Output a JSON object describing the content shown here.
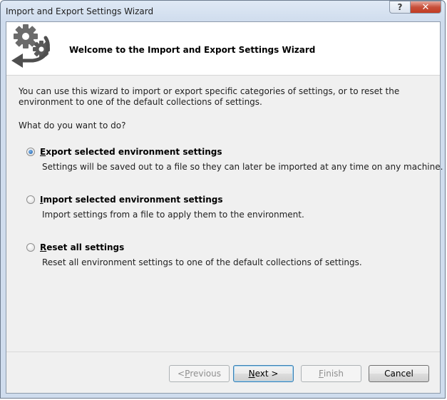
{
  "window": {
    "title": "Import and Export Settings Wizard",
    "help_label": "?",
    "close_label": "✕"
  },
  "banner": {
    "title": "Welcome to the Import and Export Settings Wizard",
    "icon": "gears-arrow-icon"
  },
  "intro": "You can use this wizard to import or export specific categories of settings, or to reset the environment to one of the default collections of settings.",
  "question": "What do you want to do?",
  "options": [
    {
      "label_accel": "E",
      "label_rest": "xport selected environment settings",
      "description": "Settings will be saved out to a file so they can later be imported at any time on any machine.",
      "selected": true
    },
    {
      "label_accel": "I",
      "label_rest": "mport selected environment settings",
      "description": "Import settings from a file to apply them to the environment.",
      "selected": false
    },
    {
      "label_accel": "R",
      "label_rest": "eset all settings",
      "description": "Reset all environment settings to one of the default collections of settings.",
      "selected": false
    }
  ],
  "buttons": {
    "previous": {
      "pre": "< ",
      "accel": "P",
      "rest": "revious",
      "enabled": false
    },
    "next": {
      "pre": "",
      "accel": "N",
      "rest": "ext >",
      "enabled": true
    },
    "finish": {
      "pre": "",
      "accel": "F",
      "rest": "inish",
      "enabled": false
    },
    "cancel": {
      "label": "Cancel",
      "enabled": true
    }
  }
}
